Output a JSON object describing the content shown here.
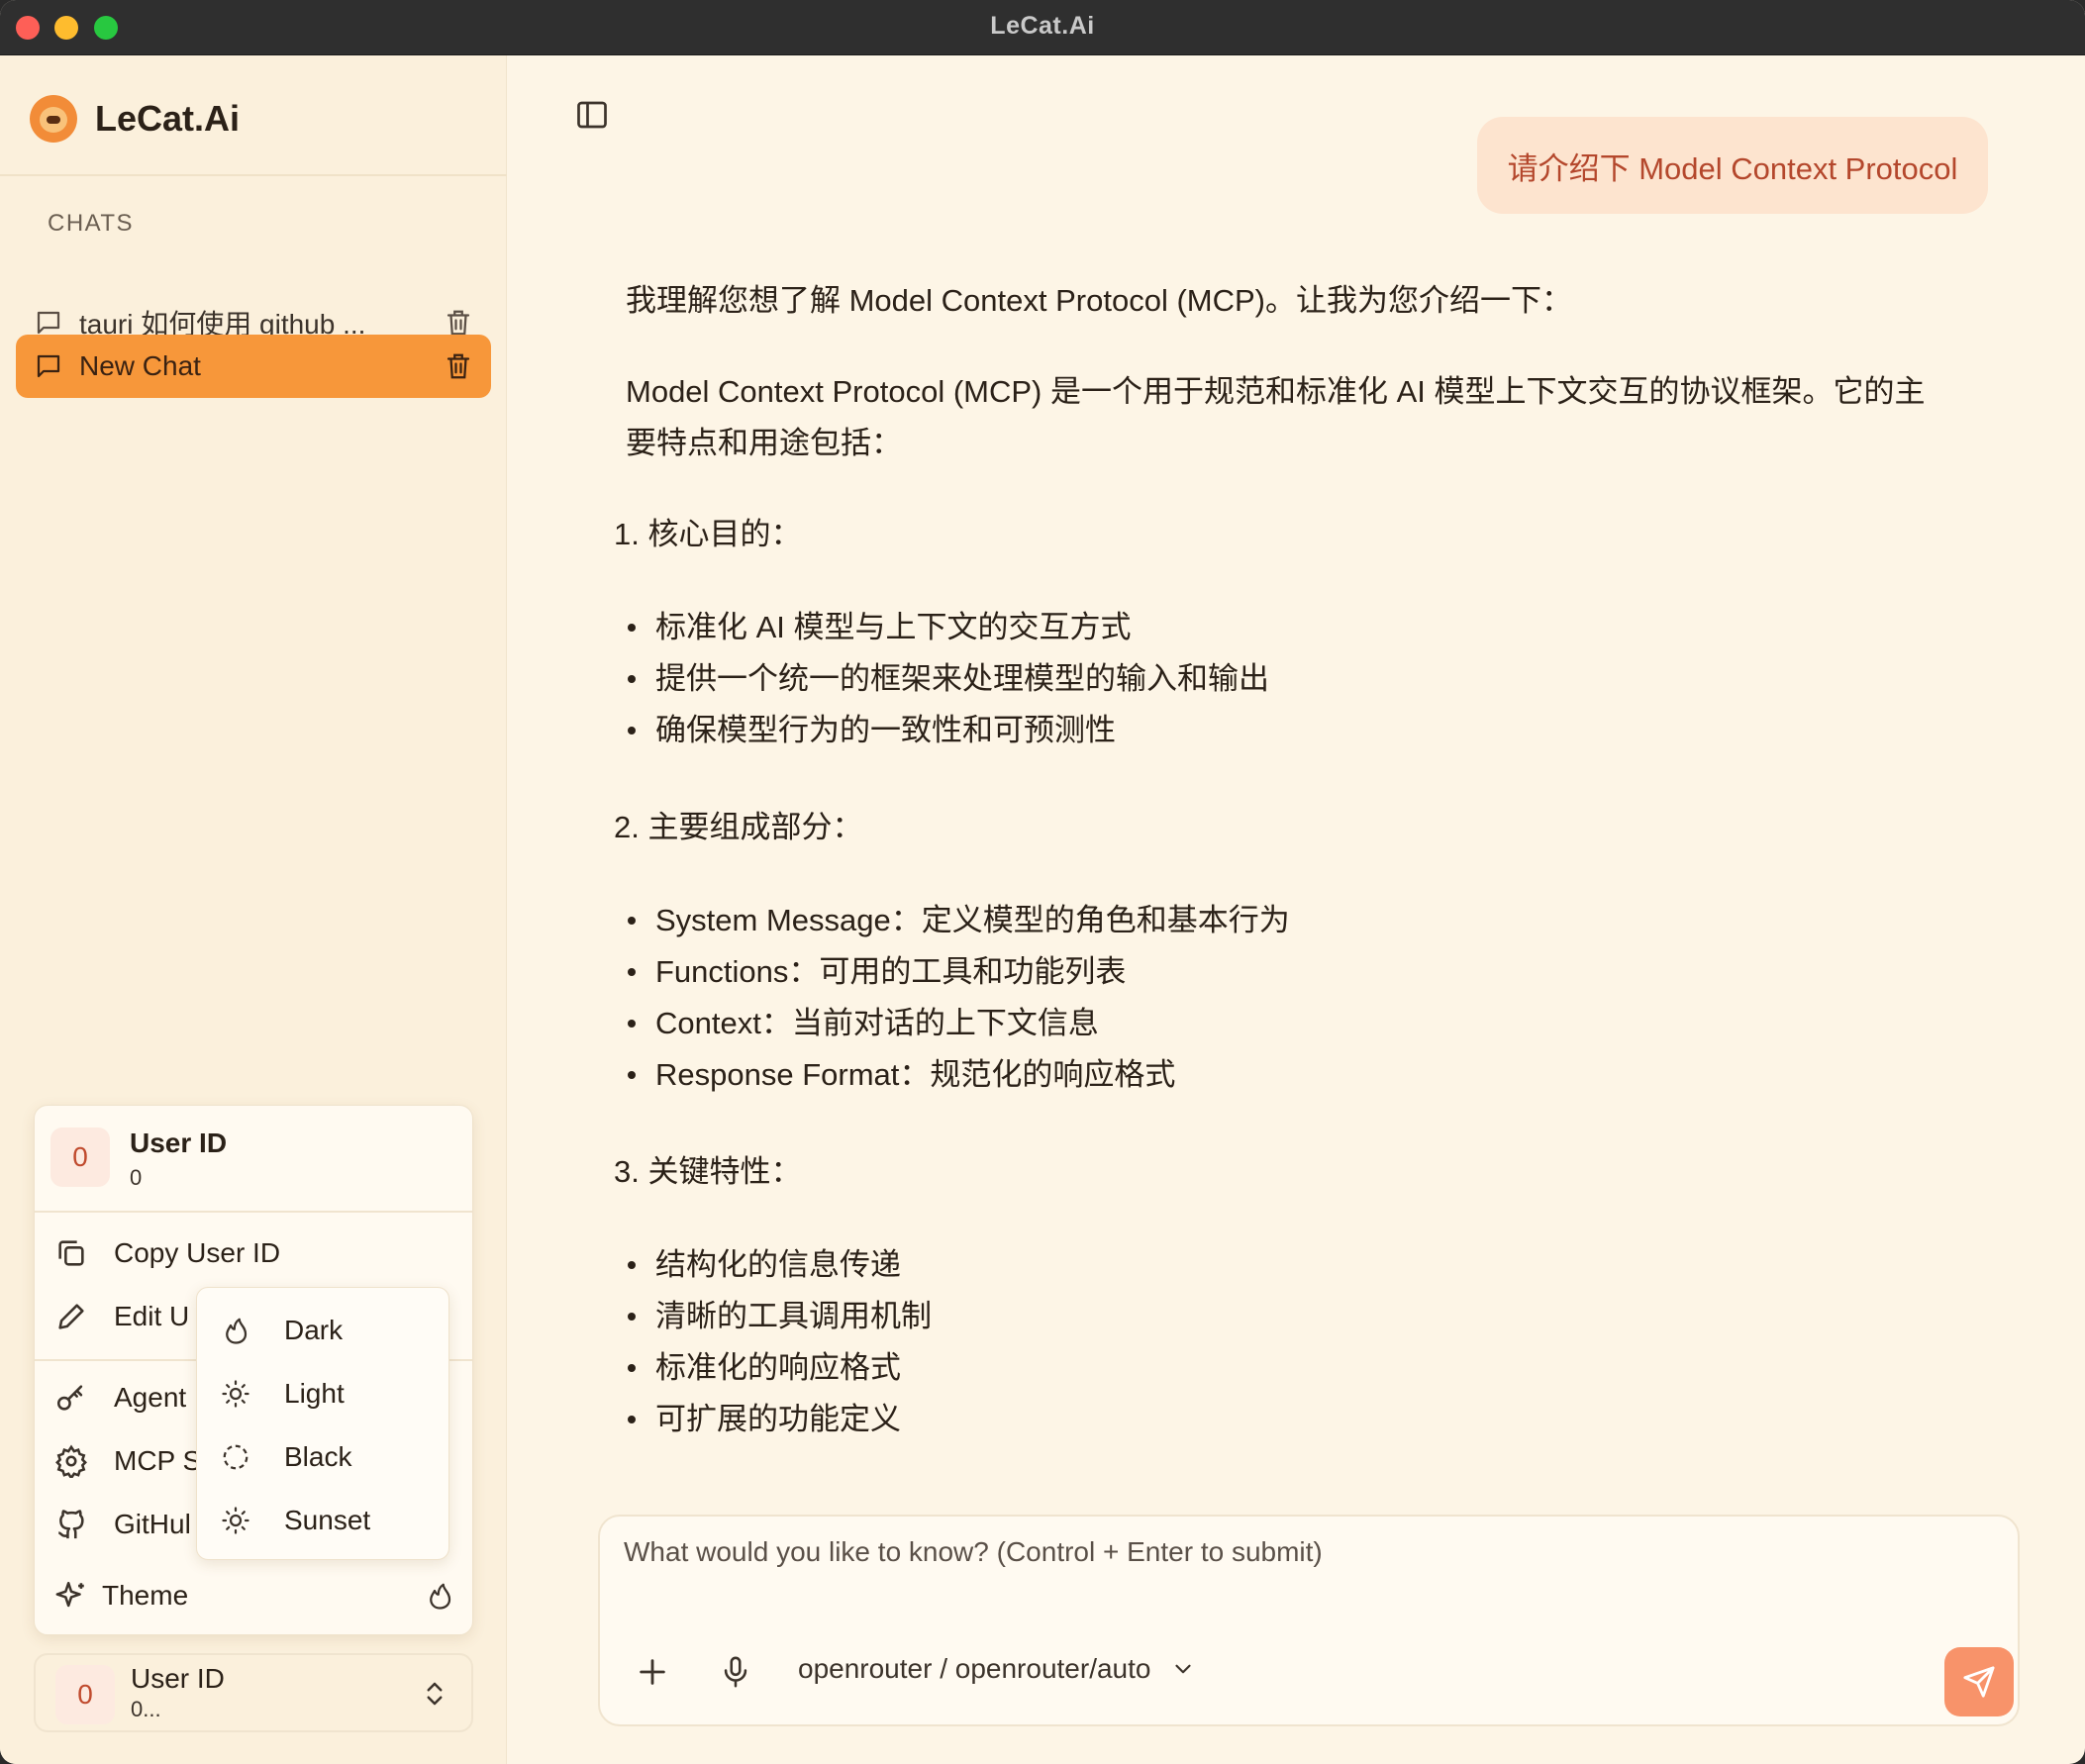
{
  "window": {
    "title": "LeCat.Ai"
  },
  "sidebar": {
    "brand": "LeCat.Ai",
    "section_label": "CHATS",
    "chats": [
      {
        "label": "tauri 如何使用 github ...",
        "active": false
      },
      {
        "label": "New Chat",
        "active": true
      }
    ]
  },
  "user_menu": {
    "avatar": "0",
    "name": "User ID",
    "sub": "0",
    "copy_label": "Copy User ID",
    "edit_label": "Edit U",
    "agent_label": "Agent",
    "mcp_label": "MCP S",
    "github_label": "GitHul",
    "theme_label": "Theme"
  },
  "theme_submenu": {
    "options": [
      {
        "label": "Dark",
        "icon": "flame-icon"
      },
      {
        "label": "Light",
        "icon": "sun-icon"
      },
      {
        "label": "Black",
        "icon": "dashed-circle-icon"
      },
      {
        "label": "Sunset",
        "icon": "sun-icon"
      }
    ]
  },
  "user_footer": {
    "avatar": "0",
    "name": "User ID",
    "sub": "0..."
  },
  "conversation": {
    "user_message": "请介绍下 Model Context Protocol",
    "assistant": {
      "intro": "我理解您想了解 Model Context Protocol (MCP)。让我为您介绍一下：",
      "para_line1": "Model Context Protocol (MCP) 是一个用于规范和标准化 AI 模型上下文交互的协议框架。它的主",
      "para_line2": "要特点和用途包括：",
      "sections": [
        {
          "heading": "1.  核心目的：",
          "items": [
            "标准化 AI 模型与上下文的交互方式",
            "提供一个统一的框架来处理模型的输入和输出",
            "确保模型行为的一致性和可预测性"
          ]
        },
        {
          "heading": "2.  主要组成部分：",
          "items": [
            "System Message：定义模型的角色和基本行为",
            "Functions：可用的工具和功能列表",
            "Context：当前对话的上下文信息",
            "Response Format：规范化的响应格式"
          ]
        },
        {
          "heading": "3.  关键特性：",
          "items": [
            "结构化的信息传递",
            "清晰的工具调用机制",
            "标准化的响应格式",
            "可扩展的功能定义"
          ]
        }
      ]
    }
  },
  "composer": {
    "placeholder": "What would you like to know? (Control + Enter to submit)",
    "model": "openrouter / openrouter/auto"
  },
  "colors": {
    "accent": "#f7973a",
    "background": "#fdf5e6",
    "sidebar": "#fbf0dc",
    "user_bubble": "#fde4cf",
    "send_button": "#f8936a"
  }
}
